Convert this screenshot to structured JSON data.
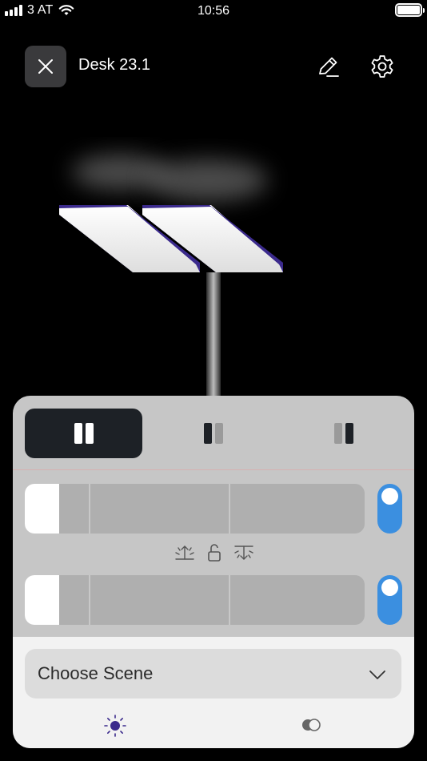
{
  "status_bar": {
    "carrier": "3 AT",
    "time": "10:56"
  },
  "header": {
    "title": "Desk 23.1"
  },
  "panel": {
    "modes": [
      "both-lights",
      "left-light",
      "right-light"
    ],
    "active_mode_index": 0,
    "sliders": [
      {
        "name": "upper",
        "level_percent": 10,
        "enabled": true
      },
      {
        "name": "lower",
        "level_percent": 10,
        "enabled": true
      }
    ],
    "scene": {
      "label": "Choose Scene"
    },
    "tabs": [
      "light",
      "color"
    ],
    "active_tab": "light"
  },
  "colors": {
    "accent_toggle": "#3b8fe0",
    "lamp_purple": "#3b2a8c",
    "active_mode": "#1d2126"
  }
}
